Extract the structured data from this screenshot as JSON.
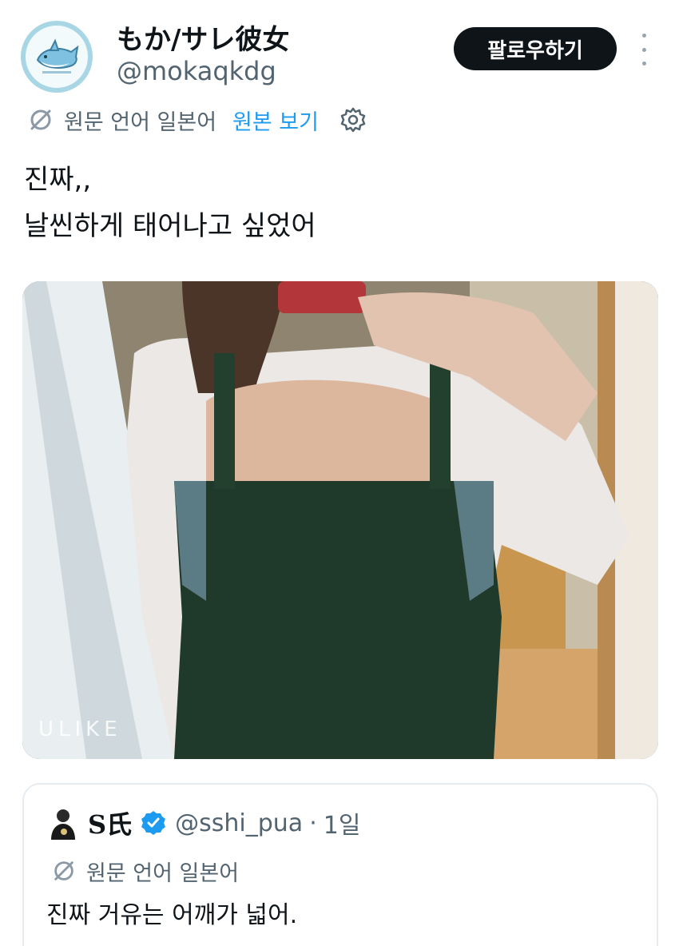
{
  "author": {
    "display_name": "もか/サレ彼女",
    "handle": "@mokaqkdg",
    "avatar_icon": "shark-icon"
  },
  "actions": {
    "follow_label": "팔로우하기",
    "more_icon": "more-vertical-icon"
  },
  "translation": {
    "source_language": "원문 언어 일본어",
    "show_original_label": "원본 보기",
    "translate_icon": "translate-icon",
    "settings_icon": "gear-icon"
  },
  "tweet": {
    "lines": [
      "진짜,,",
      "날씬하게 태어나고 싶었어"
    ]
  },
  "media": {
    "watermark": "ULIKE"
  },
  "quote": {
    "name": "S氏",
    "verified": true,
    "handle": "@sshi_pua",
    "separator": "·",
    "time": "1일",
    "source_language": "원문 언어 일본어",
    "text": "진짜 거유는 어깨가 넓어."
  },
  "colors": {
    "link": "#1d9bf0",
    "secondary_text": "#536471",
    "follow_button": "#0f1419",
    "avatar_ring": "#a9d6e4"
  }
}
